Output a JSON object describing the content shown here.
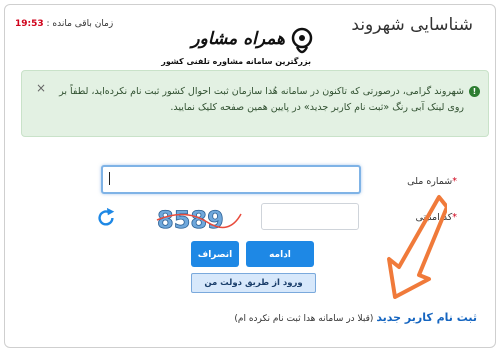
{
  "header": {
    "title": "شناسایی شهروند",
    "timer_label": "زمان باقی مانده :",
    "timer_value": "19:53"
  },
  "logo": {
    "title": "همراه مشاور",
    "subtitle": "بزرگترین سامانه مشاوره تلفنی کشور"
  },
  "alert": {
    "icon": "info-icon",
    "close": "×",
    "text": "شهروند گرامی، درصورتی که تاکنون در سامانه هُدا سازمان ثبت احوال کشور ثبت نام نکرده‌اید، لطفاً بر روی لینک آبی رنگ «ثبت نام کاربر جدید» در پایین همین صفحه کلیک نمایید."
  },
  "form": {
    "national_id_label": "شماره ملی",
    "national_id_value": "",
    "security_code_label": "کد امنیتی",
    "security_code_value": "",
    "required_mark": "*",
    "captcha_text": "8589"
  },
  "buttons": {
    "continue": "ادامه",
    "cancel": "انصراف",
    "gov_login": "ورود از طریق دولت من"
  },
  "register": {
    "link": "ثبت نام کاربر جدید",
    "note": "(قبلا در سامانه هدا ثبت نام نکرده ام)"
  },
  "colors": {
    "accent": "#1e88e5",
    "alert_bg": "#e3f1e3",
    "timer": "#d0021b",
    "arrow": "#f07a3a"
  }
}
